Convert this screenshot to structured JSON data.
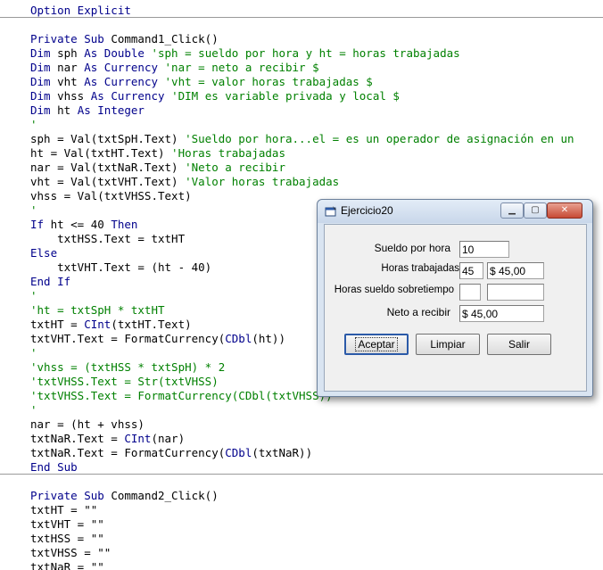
{
  "editor": {
    "lines": [
      [
        [
          "kw",
          "Option Explicit"
        ]
      ],
      [],
      [
        [
          "kw",
          "Private Sub "
        ],
        [
          "pl",
          "Command1_Click()"
        ]
      ],
      [
        [
          "kw",
          "Dim "
        ],
        [
          "pl",
          "sph "
        ],
        [
          "kw",
          "As Double "
        ],
        [
          "cm",
          "'sph = sueldo por hora y ht = horas trabajadas"
        ]
      ],
      [
        [
          "kw",
          "Dim "
        ],
        [
          "pl",
          "nar "
        ],
        [
          "kw",
          "As Currency "
        ],
        [
          "cm",
          "'nar = neto a recibir $"
        ]
      ],
      [
        [
          "kw",
          "Dim "
        ],
        [
          "pl",
          "vht "
        ],
        [
          "kw",
          "As Currency "
        ],
        [
          "cm",
          "'vht = valor horas trabajadas $"
        ]
      ],
      [
        [
          "kw",
          "Dim "
        ],
        [
          "pl",
          "vhss "
        ],
        [
          "kw",
          "As Currency "
        ],
        [
          "cm",
          "'DIM es variable privada y local $"
        ]
      ],
      [
        [
          "kw",
          "Dim "
        ],
        [
          "pl",
          "ht "
        ],
        [
          "kw",
          "As Integer"
        ]
      ],
      [
        [
          "cm",
          "'"
        ]
      ],
      [
        [
          "pl",
          "sph = Val(txtSpH.Text) "
        ],
        [
          "cm",
          "'Sueldo por hora...el = es un operador de asignación en un"
        ]
      ],
      [
        [
          "pl",
          "ht = Val(txtHT.Text) "
        ],
        [
          "cm",
          "'Horas trabajadas"
        ]
      ],
      [
        [
          "pl",
          "nar = Val(txtNaR.Text) "
        ],
        [
          "cm",
          "'Neto a recibir"
        ]
      ],
      [
        [
          "pl",
          "vht = Val(txtVHT.Text) "
        ],
        [
          "cm",
          "'Valor horas trabajadas"
        ]
      ],
      [
        [
          "pl",
          "vhss = Val(txtVHSS.Text)"
        ]
      ],
      [
        [
          "cm",
          "'"
        ]
      ],
      [
        [
          "kw",
          "If "
        ],
        [
          "pl",
          "ht <= 40 "
        ],
        [
          "kw",
          "Then"
        ]
      ],
      [
        [
          "pl",
          "    txtHSS.Text = txtHT"
        ]
      ],
      [
        [
          "kw",
          "Else"
        ]
      ],
      [
        [
          "pl",
          "    txtVHT.Text = (ht - 40)"
        ]
      ],
      [
        [
          "kw",
          "End If"
        ]
      ],
      [
        [
          "cm",
          "'"
        ]
      ],
      [
        [
          "cm",
          "'ht = txtSpH * txtHT"
        ]
      ],
      [
        [
          "pl",
          "txtHT = "
        ],
        [
          "kw",
          "CInt"
        ],
        [
          "pl",
          "(txtHT.Text)"
        ]
      ],
      [
        [
          "pl",
          "txtVHT.Text = FormatCurrency("
        ],
        [
          "kw",
          "CDbl"
        ],
        [
          "pl",
          "(ht))"
        ]
      ],
      [
        [
          "cm",
          "'"
        ]
      ],
      [
        [
          "cm",
          "'vhss = (txtHSS * txtSpH) * 2"
        ]
      ],
      [
        [
          "cm",
          "'txtVHSS.Text = Str(txtVHSS)"
        ]
      ],
      [
        [
          "cm",
          "'txtVHSS.Text = FormatCurrency(CDbl(txtVHSS))"
        ]
      ],
      [
        [
          "cm",
          "'"
        ]
      ],
      [
        [
          "pl",
          "nar = (ht + vhss)"
        ]
      ],
      [
        [
          "pl",
          "txtNaR.Text = "
        ],
        [
          "kw",
          "CInt"
        ],
        [
          "pl",
          "(nar)"
        ]
      ],
      [
        [
          "pl",
          "txtNaR.Text = FormatCurrency("
        ],
        [
          "kw",
          "CDbl"
        ],
        [
          "pl",
          "(txtNaR))"
        ]
      ],
      [
        [
          "kw",
          "End Sub"
        ]
      ],
      [],
      [
        [
          "kw",
          "Private Sub "
        ],
        [
          "pl",
          "Command2_Click()"
        ]
      ],
      [
        [
          "pl",
          "txtHT = \"\""
        ]
      ],
      [
        [
          "pl",
          "txtVHT = \"\""
        ]
      ],
      [
        [
          "pl",
          "txtHSS = \"\""
        ]
      ],
      [
        [
          "pl",
          "txtVHSS = \"\""
        ]
      ],
      [
        [
          "pl",
          "txtNaR = \"\""
        ]
      ]
    ],
    "colors": {
      "keyword": "#00008b",
      "comment": "#008000",
      "plain": "#000000"
    }
  },
  "dialog": {
    "title": "Ejercicio20",
    "app_icon": "form-icon",
    "caption_buttons": {
      "minimize": "minimize-icon",
      "maximize": "maximize-icon",
      "close": "close-icon"
    },
    "labels": {
      "sueldo_por_hora": "Sueldo por hora",
      "horas_trabajadas": "Horas trabajadas",
      "horas_sueldo_sobretiempo": "Horas sueldo sobretiempo",
      "neto_a_recibir": "Neto a recibir"
    },
    "fields": {
      "txtSpH": "10",
      "txtHT": "45",
      "txtVHT": "$ 45,00",
      "txtHSS": "",
      "txtVHSS": "",
      "txtNaR": "$ 45,00"
    },
    "buttons": {
      "aceptar": "Aceptar",
      "limpiar": "Limpiar",
      "salir": "Salir"
    }
  }
}
